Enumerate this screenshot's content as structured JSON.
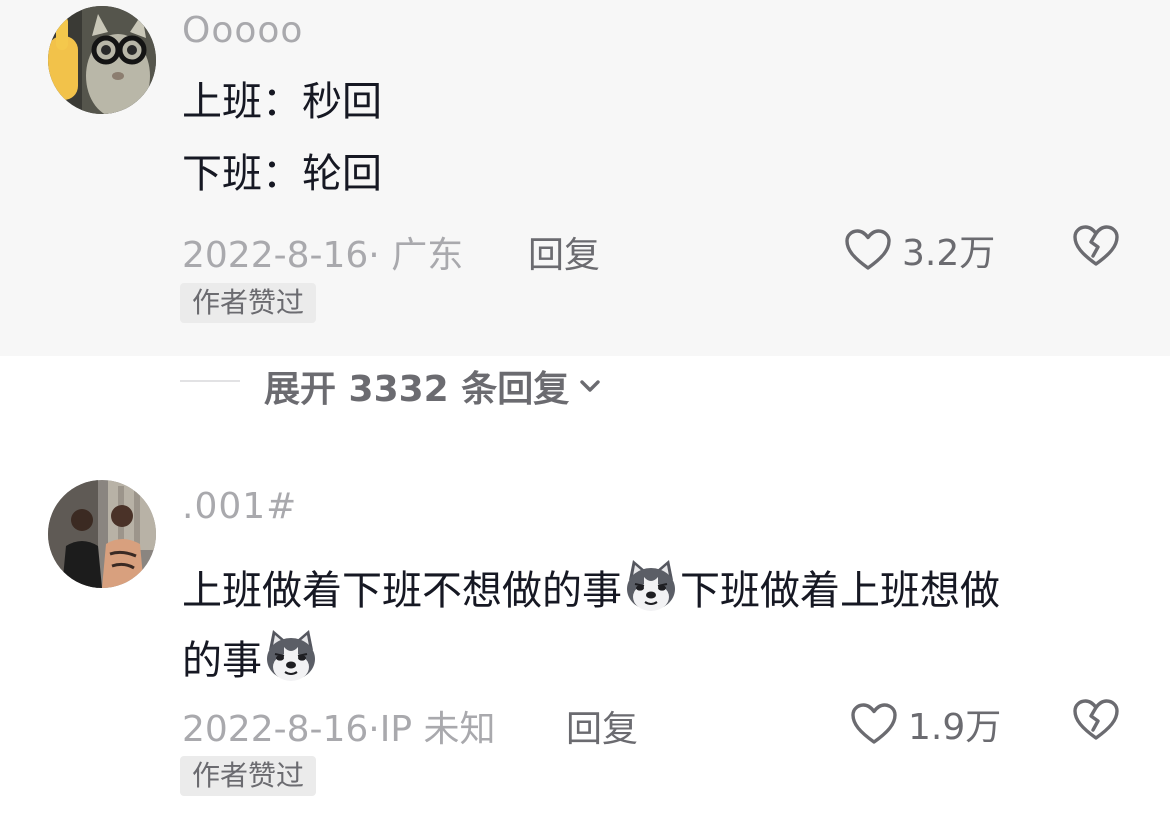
{
  "colors": {
    "text_primary": "#161823",
    "text_secondary": "#a9a9ad",
    "text_action": "#6b6b70",
    "highlight_bg": "#f7f7f7",
    "badge_bg": "#ebebeb"
  },
  "comments": [
    {
      "username": "Ooooo",
      "avatar_icon": "cat-with-glasses-avatar",
      "lines": [
        "上班：秒回",
        "下班：轮回"
      ],
      "meta": "2022-8-16· 广东",
      "reply_label": "回复",
      "like_count": "3.2万",
      "badge": "作者赞过"
    },
    {
      "username": ".001#",
      "avatar_icon": "two-people-photo-avatar",
      "lines": [
        "上班做着下班不想做的事",
        "下班做着上班想做",
        "的事"
      ],
      "emoji_icon": "husky-dog-emoji",
      "meta": "2022-8-16·IP 未知",
      "reply_label": "回复",
      "like_count": "1.9万",
      "badge": "作者赞过"
    }
  ],
  "expand": {
    "label": "展开 3332 条回复"
  }
}
